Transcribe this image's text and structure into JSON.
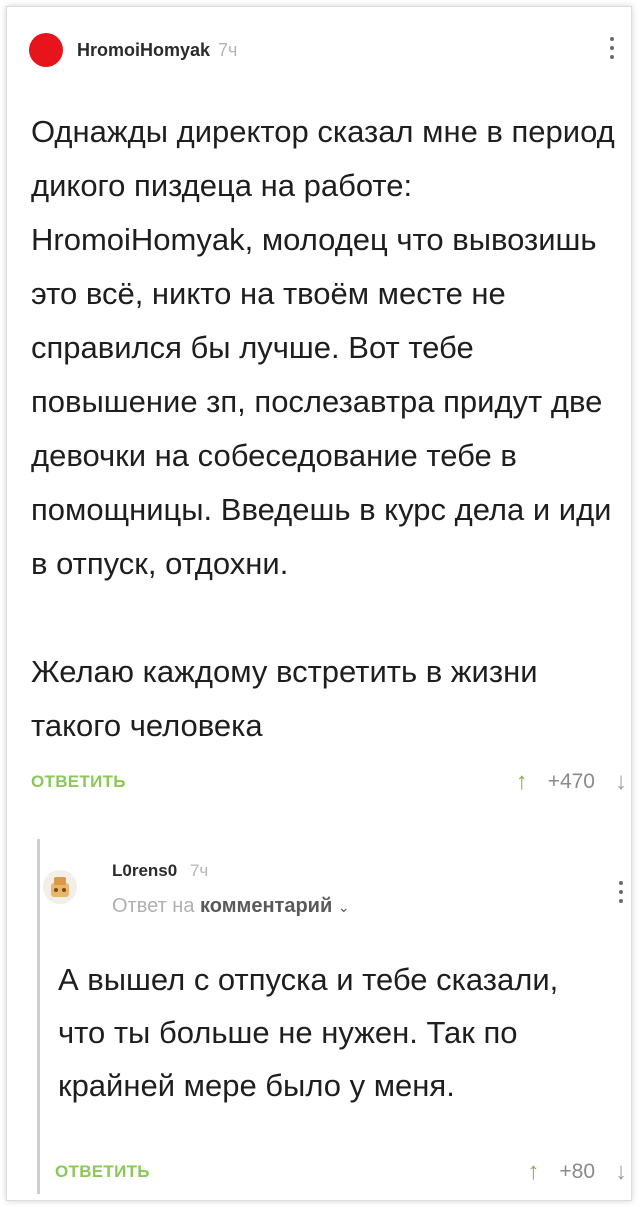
{
  "post": {
    "author": "HromoiHomyak",
    "time": "7ч",
    "paragraphs": [
      "Однажды директор сказал мне в период дикого пиздеца на работе: HromoiHomyak, молодец что вывозишь это всё, никто на твоём месте не справился бы лучше. Вот тебе повышение зп, послезавтра придут две девочки на собеседование тебе в помощницы. Введешь в курс дела и иди в отпуск, отдохни.",
      "Желаю каждому встретить в жизни такого человека"
    ],
    "reply_label": "ОТВЕТИТЬ",
    "score": "+470",
    "up_arrow": "↑",
    "down_arrow": "↓"
  },
  "reply": {
    "author": "L0rens0",
    "time": "7ч",
    "reply_to_prefix": "Ответ на",
    "reply_to_target": "комментарий",
    "chevron": "⌄",
    "text": "А вышел с отпуска и тебе сказали, что ты больше не нужен. Так по крайней мере было у меня.",
    "reply_label": "ОТВЕТИТЬ",
    "score": "+80",
    "up_arrow": "↑",
    "down_arrow": "↓"
  },
  "colors": {
    "avatar_red": "#e8141c",
    "accent_green": "#8ac858"
  },
  "icons": {
    "menu": "kebab-icon",
    "upvote": "arrow-up-icon",
    "downvote": "arrow-down-icon"
  }
}
